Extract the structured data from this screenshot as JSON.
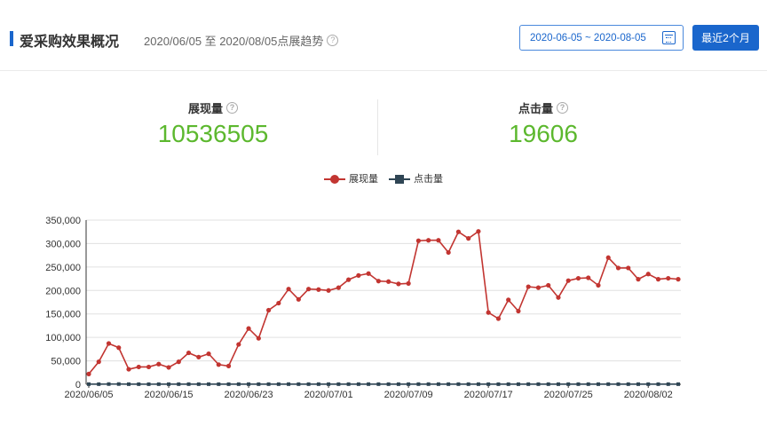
{
  "header": {
    "title": "爱采购效果概况",
    "subtitle": "2020/06/05 至 2020/08/05点展趋势",
    "date_range": "2020-06-05 ~ 2020-08-05",
    "recent_button": "最近2个月"
  },
  "stats": {
    "impressions": {
      "label": "展现量",
      "value": "10536505"
    },
    "clicks": {
      "label": "点击量",
      "value": "19606"
    }
  },
  "help_glyph": "?",
  "colors": {
    "accent": "#1a66cc",
    "impressions": "#c23531",
    "clicks": "#2f4554",
    "stat_value": "#5cb82e"
  },
  "chart_data": {
    "type": "line",
    "legend": [
      "展现量",
      "点击量"
    ],
    "legend_position": "top-center",
    "x_tick_labels": [
      "2020/06/05",
      "2020/06/15",
      "2020/06/23",
      "2020/07/01",
      "2020/07/09",
      "2020/07/17",
      "2020/07/25",
      "2020/08/02"
    ],
    "x_tick_indices": [
      0,
      8,
      16,
      24,
      32,
      40,
      48,
      56
    ],
    "y_tick_labels": [
      "0",
      "50,000",
      "100,000",
      "150,000",
      "200,000",
      "250,000",
      "300,000",
      "350,000"
    ],
    "ylim": [
      0,
      350000
    ],
    "grid": true,
    "series": [
      {
        "name": "展现量",
        "values": [
          22000,
          48000,
          87000,
          78000,
          32000,
          37000,
          37000,
          43000,
          36000,
          48000,
          67000,
          58000,
          65000,
          42000,
          39000,
          85000,
          119000,
          98000,
          158000,
          173000,
          203000,
          181000,
          203000,
          202000,
          200000,
          206000,
          223000,
          232000,
          236000,
          220000,
          219000,
          214000,
          215000,
          306000,
          307000,
          307000,
          281000,
          325000,
          311000,
          326000,
          153000,
          140000,
          180000,
          156000,
          208000,
          206000,
          211000,
          185000,
          221000,
          226000,
          227000,
          211000,
          270000,
          248000,
          248000,
          224000,
          235000,
          224000,
          226000,
          224000
        ]
      },
      {
        "name": "点击量",
        "values": [
          350,
          310,
          480,
          520,
          300,
          280,
          260,
          300,
          290,
          320,
          350,
          300,
          320,
          280,
          290,
          330,
          350,
          300,
          340,
          320,
          360,
          330,
          340,
          350,
          330,
          320,
          350,
          340,
          360,
          330,
          320,
          310,
          320,
          380,
          370,
          360,
          340,
          350,
          330,
          340,
          280,
          270,
          290,
          280,
          330,
          320,
          330,
          300,
          330,
          340,
          340,
          310,
          350,
          340,
          330,
          320,
          340,
          320,
          330,
          320
        ]
      }
    ]
  }
}
